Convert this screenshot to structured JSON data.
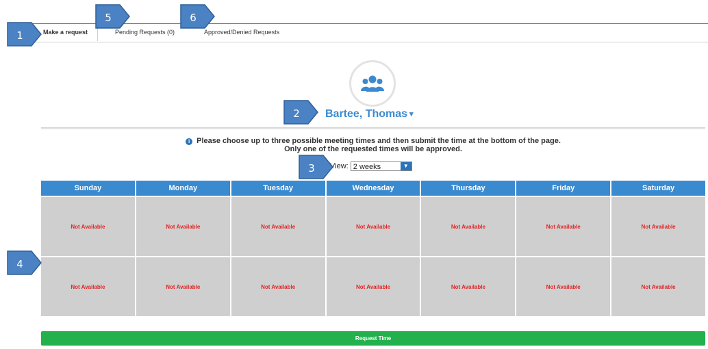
{
  "tabs": [
    {
      "label": "Make a request",
      "active": true
    },
    {
      "label": "Pending Requests (0)"
    },
    {
      "label": "Approved/Denied Requests"
    }
  ],
  "avatar_icon": "users-icon",
  "person_name": "Bartee, Thomas",
  "info": {
    "line1": "Please choose up to three possible meeting times and then submit the time at the bottom of the page.",
    "line2": "Only one of the requested times will be approved."
  },
  "view": {
    "label": "View:",
    "selected": "2 weeks"
  },
  "calendar": {
    "days": [
      "Sunday",
      "Monday",
      "Tuesday",
      "Wednesday",
      "Thursday",
      "Friday",
      "Saturday"
    ],
    "weeks": [
      [
        "Not Available",
        "Not Available",
        "Not Available",
        "Not Available",
        "Not Available",
        "Not Available",
        "Not Available"
      ],
      [
        "Not Available",
        "Not Available",
        "Not Available",
        "Not Available",
        "Not Available",
        "Not Available",
        "Not Available"
      ]
    ]
  },
  "request_button": "Request Time",
  "markers": [
    "1",
    "2",
    "3",
    "4",
    "5",
    "6"
  ],
  "colors": {
    "primary": "#3a8ad0",
    "unavailable": "#e02525",
    "cell": "#cfcfcf",
    "request": "#22b14c",
    "marker": "#4a82c4"
  }
}
